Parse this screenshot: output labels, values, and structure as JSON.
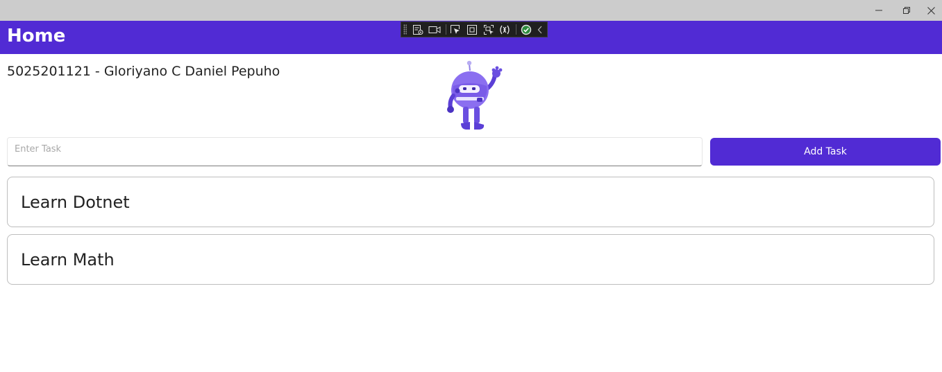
{
  "window": {
    "controls": {
      "minimize_icon": "minimize-icon",
      "maximize_icon": "restore-icon",
      "close_icon": "close-icon"
    }
  },
  "header": {
    "title": "Home",
    "background": "#512bd4"
  },
  "devtools": {
    "icons": [
      "live-visual-tree-icon",
      "record-icon",
      "select-element-icon",
      "display-adorners-icon",
      "track-focus-icon",
      "binding-failures-icon",
      "hot-reload-ok-icon",
      "collapse-icon"
    ]
  },
  "student": {
    "text": "5025201121 - Gloriyano C Daniel Pepuho"
  },
  "mascot": {
    "name": "dotnet-bot-mascot"
  },
  "task_input": {
    "placeholder": "Enter Task",
    "value": ""
  },
  "add_button": {
    "label": "Add Task"
  },
  "tasks": [
    {
      "label": "Learn Dotnet"
    },
    {
      "label": "Learn Math"
    }
  ]
}
